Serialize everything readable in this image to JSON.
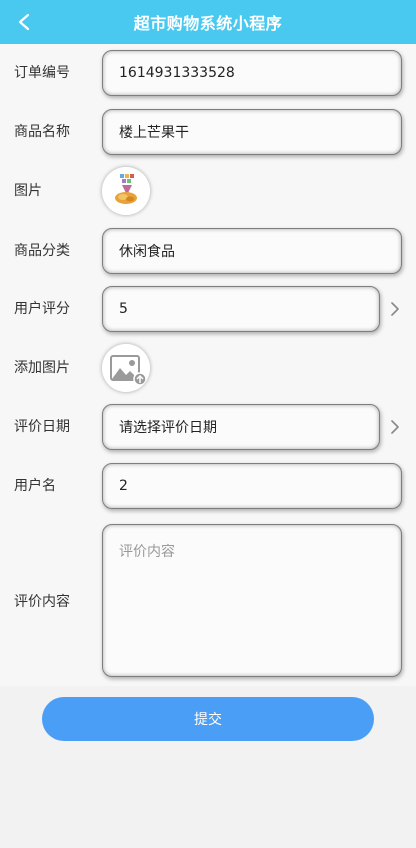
{
  "header": {
    "title": "超市购物系统小程序",
    "back_icon": "chevron-left-icon",
    "color": "#4ac9f0"
  },
  "form": {
    "order_no": {
      "label": "订单编号",
      "value": "1614931333528"
    },
    "product_name": {
      "label": "商品名称",
      "value": "楼上芒果干"
    },
    "image": {
      "label": "图片",
      "icon": "product-photo-icon"
    },
    "category": {
      "label": "商品分类",
      "value": "休闲食品"
    },
    "rating": {
      "label": "用户评分",
      "value": "5"
    },
    "add_image": {
      "label": "添加图片",
      "icon": "image-upload-icon"
    },
    "review_date": {
      "label": "评价日期",
      "value": "请选择评价日期"
    },
    "username": {
      "label": "用户名",
      "value": "2"
    },
    "review_content": {
      "label": "评价内容",
      "placeholder": "评价内容"
    }
  },
  "submit": {
    "label": "提交",
    "color": "#4a9ef5"
  }
}
